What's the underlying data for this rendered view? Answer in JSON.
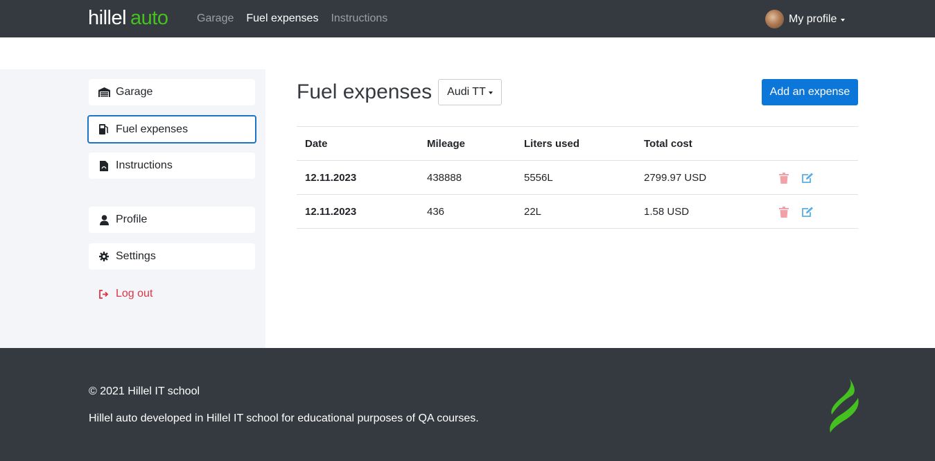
{
  "header": {
    "logo_white": "hillel",
    "logo_green": "auto",
    "nav": [
      {
        "label": "Garage",
        "active": false
      },
      {
        "label": "Fuel expenses",
        "active": true
      },
      {
        "label": "Instructions",
        "active": false
      }
    ],
    "profile_label": "My profile"
  },
  "sidebar": {
    "items": [
      {
        "label": "Garage",
        "icon": "garage-icon"
      },
      {
        "label": "Fuel expenses",
        "icon": "fuel-pump-icon",
        "active": true
      },
      {
        "label": "Instructions",
        "icon": "pdf-file-icon"
      },
      {
        "label": "Profile",
        "icon": "user-icon"
      },
      {
        "label": "Settings",
        "icon": "gear-icon"
      }
    ],
    "logout_label": "Log out"
  },
  "main": {
    "title": "Fuel expenses",
    "car_select": "Audi TT",
    "add_button": "Add an expense",
    "table": {
      "headers": [
        "Date",
        "Mileage",
        "Liters used",
        "Total cost"
      ],
      "rows": [
        {
          "date": "12.11.2023",
          "mileage": "438888",
          "liters": "5556L",
          "cost": "2799.97 USD"
        },
        {
          "date": "12.11.2023",
          "mileage": "436",
          "liters": "22L",
          "cost": "1.58 USD"
        }
      ]
    }
  },
  "footer": {
    "copyright": "© 2021 Hillel IT school",
    "about": "Hillel auto developed in Hillel IT school for educational purposes of QA courses."
  },
  "colors": {
    "header_bg": "#343a40",
    "brand_green": "#45c11f",
    "primary": "#0c77d8",
    "danger": "#dc3545",
    "delete_icon": "#f1a1a7",
    "edit_icon": "#5aaee6"
  }
}
